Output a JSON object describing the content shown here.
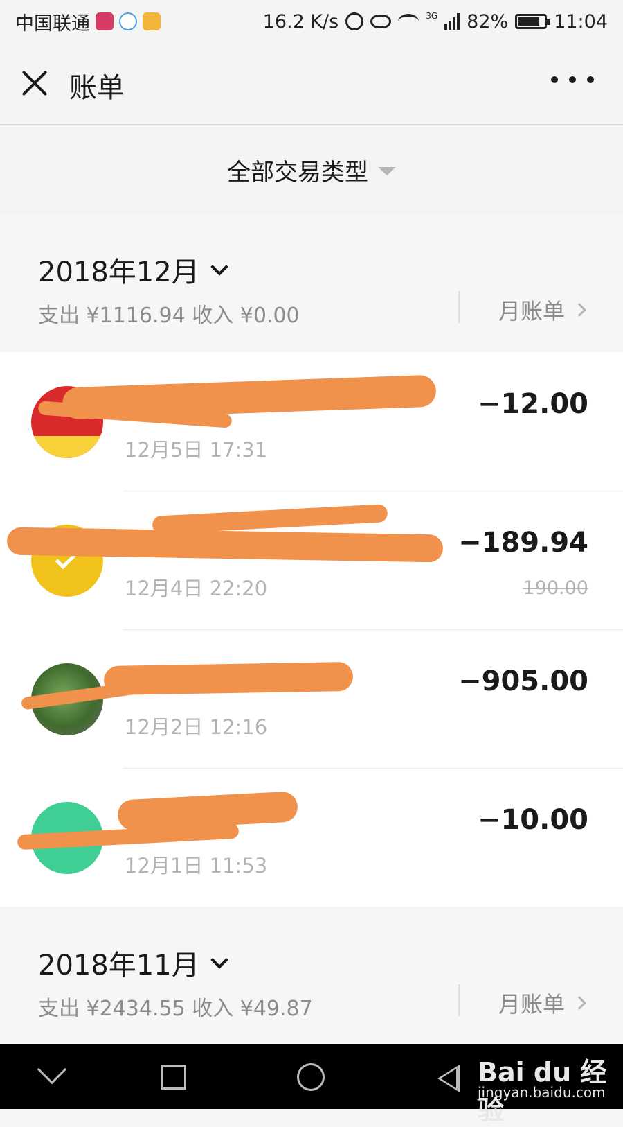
{
  "status_bar": {
    "carrier": "中国联通",
    "speed": "16.2 K/s",
    "network": "3G",
    "battery": "82%",
    "battery_level": 0.82,
    "time": "11:04"
  },
  "header": {
    "title": "账单"
  },
  "filter": {
    "label": "全部交易类型"
  },
  "months": [
    {
      "title": "2018年12月",
      "summary": "支出 ¥1116.94 收入 ¥0.00",
      "bill_link": "月账单"
    },
    {
      "title": "2018年11月",
      "summary": "支出 ¥2434.55 收入 ¥49.87",
      "bill_link": "月账单"
    }
  ],
  "transactions": [
    {
      "avatar": "shou-fulishe-logo",
      "time": "12月5日 17:31",
      "amount": "−12.00"
    },
    {
      "avatar": "payment-check-logo",
      "time": "12月4日 22:20",
      "amount": "−189.94",
      "original_amount": "190.00"
    },
    {
      "avatar": "tree-photo",
      "time": "12月2日 12:16",
      "amount": "−905.00"
    },
    {
      "avatar": "meituan-logo",
      "time": "12月1日 11:53",
      "amount": "−10.00"
    }
  ],
  "watermark": {
    "brand": "Bai du 经验",
    "url": "jingyan.baidu.com"
  },
  "colors": {
    "redaction": "#f0914c",
    "background": "#f6f6f7"
  }
}
